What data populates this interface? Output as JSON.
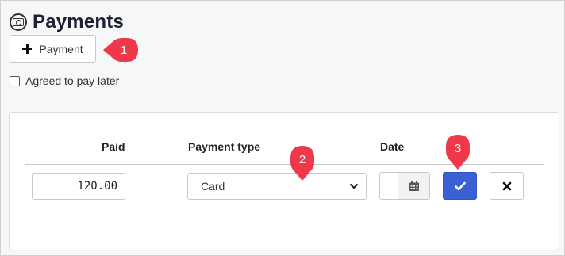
{
  "header": {
    "title": "Payments",
    "icon": "money-bill-icon"
  },
  "toolbar": {
    "add_payment_label": "Payment",
    "add_icon": "plus-icon"
  },
  "agreement": {
    "label": "Agreed to pay later",
    "checked": false
  },
  "table": {
    "columns": [
      "Paid",
      "Payment type",
      "Date"
    ],
    "row": {
      "paid": "120.00",
      "payment_type": "Card",
      "date": ""
    },
    "confirm_icon": "check-icon",
    "cancel_icon": "close-icon",
    "calendar_icon": "calendar-icon"
  },
  "annotations": {
    "markers": [
      "1",
      "2",
      "3"
    ],
    "color": "#f0384b"
  },
  "colors": {
    "confirm_button": "#3b5fd4",
    "marker": "#f0384b",
    "title": "#1a2233"
  }
}
